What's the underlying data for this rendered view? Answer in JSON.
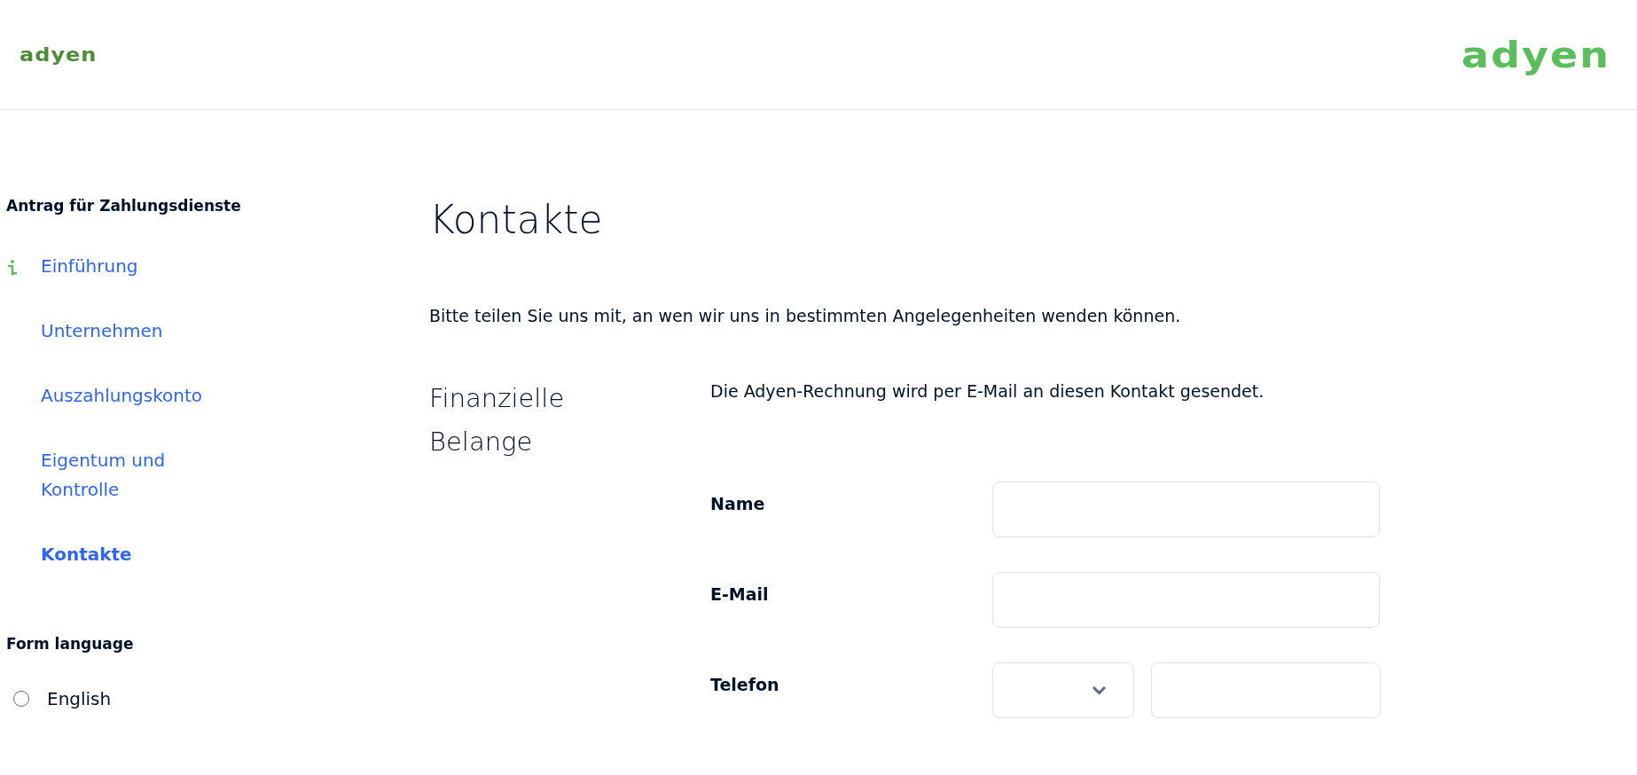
{
  "header": {
    "logo_left": "adyen",
    "logo_right": "adyen"
  },
  "sidebar": {
    "title": "Antrag für Zahlungsdienste",
    "items": [
      {
        "label": "Einführung",
        "selected": false,
        "info": true
      },
      {
        "label": "Unternehmen",
        "selected": false,
        "info": false
      },
      {
        "label": "Auszahlungskonto",
        "selected": false,
        "info": false
      },
      {
        "label": "Eigentum und Kontrolle",
        "selected": false,
        "info": false
      },
      {
        "label": "Kontakte",
        "selected": true,
        "info": false
      }
    ],
    "language_title": "Form language",
    "languages": [
      {
        "label": "English",
        "selected": false
      }
    ]
  },
  "main": {
    "title": "Kontakte",
    "intro": "Bitte teilen Sie uns mit, an wen wir uns in bestimmten Angelegenheiten wenden können.",
    "section": {
      "title": "Finanzielle Belange",
      "description": "Die Adyen-Rechnung wird per E-Mail an diesen Kontakt gesendet.",
      "fields": [
        {
          "label": "Name",
          "kind": "text"
        },
        {
          "label": "E-Mail",
          "kind": "text"
        },
        {
          "label": "Telefon",
          "kind": "phone"
        }
      ]
    }
  }
}
